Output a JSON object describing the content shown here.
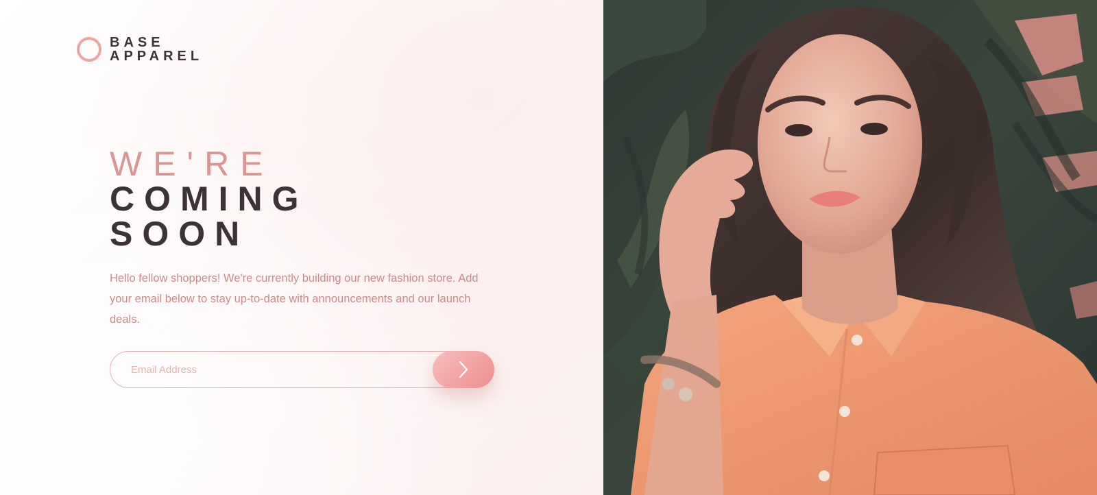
{
  "brand": {
    "line1": "BASE",
    "line2": "APPAREL"
  },
  "hero": {
    "headline_light": "WE'RE",
    "headline_strong_1": "COMING",
    "headline_strong_2": "SOON",
    "description": "Hello fellow shoppers! We're currently building our new fashion store. Add your email below to stay up-to-date with announcements and our launch deals."
  },
  "form": {
    "email_placeholder": "Email Address",
    "email_value": "",
    "submit_icon": "chevron-right-icon"
  },
  "colors": {
    "accent": "#ee8c8c",
    "accent_light": "#f8bfbf",
    "text_dark": "#3d3334",
    "text_desaturated_red": "#c98c8c",
    "background": "#fdf6f5"
  },
  "photo": {
    "subject": "hero-model-photo"
  }
}
